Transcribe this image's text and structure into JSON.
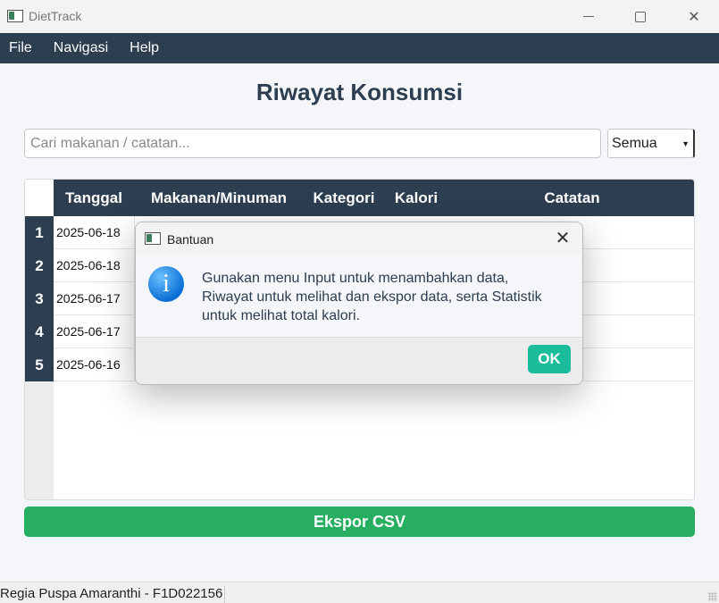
{
  "window": {
    "title": "DietTrack"
  },
  "menu": {
    "items": [
      "File",
      "Navigasi",
      "Help"
    ]
  },
  "page": {
    "title": "Riwayat Konsumsi"
  },
  "search": {
    "placeholder": "Cari makanan / catatan...",
    "value": ""
  },
  "filter": {
    "selected": "Semua"
  },
  "table": {
    "headers": [
      "Tanggal",
      "Makanan/Minuman",
      "Kategori",
      "Kalori",
      "Catatan"
    ],
    "rows": [
      {
        "num": "1",
        "tanggal": "2025-06-18"
      },
      {
        "num": "2",
        "tanggal": "2025-06-18"
      },
      {
        "num": "3",
        "tanggal": "2025-06-17"
      },
      {
        "num": "4",
        "tanggal": "2025-06-17"
      },
      {
        "num": "5",
        "tanggal": "2025-06-16"
      }
    ]
  },
  "export": {
    "label": "Ekspor CSV"
  },
  "status": {
    "text": "Regia Puspa Amaranthi - F1D022156"
  },
  "dialog": {
    "title": "Bantuan",
    "message_lines": [
      "Gunakan menu Input untuk menambahkan data,",
      "Riwayat untuk melihat dan ekspor data, serta Statistik",
      "untuk melihat total kalori."
    ],
    "ok_label": "OK",
    "info_glyph": "i"
  },
  "colors": {
    "header_bg": "#2c3e50",
    "export_green": "#27ae60",
    "ok_teal": "#1abc9c",
    "info_blue": "#0a6fd6"
  }
}
